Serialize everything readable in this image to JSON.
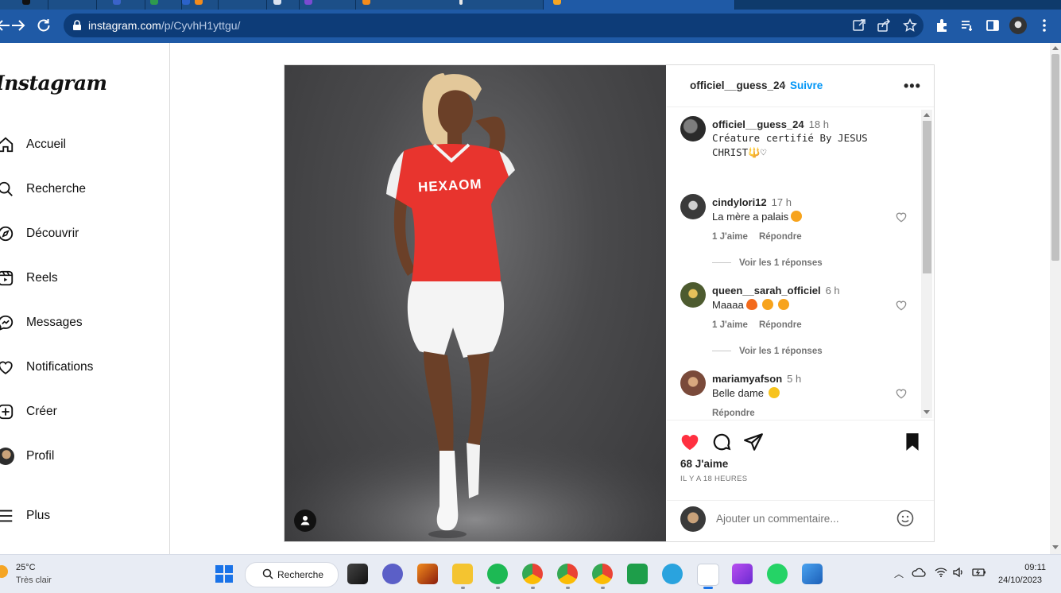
{
  "browser": {
    "url_host": "instagram.com",
    "url_path": "/p/CyvhH1yttgu/"
  },
  "sidebar": {
    "logo": "Instagram",
    "items": [
      {
        "label": "Accueil",
        "icon": "home-icon"
      },
      {
        "label": "Recherche",
        "icon": "search-icon"
      },
      {
        "label": "Découvrir",
        "icon": "compass-icon"
      },
      {
        "label": "Reels",
        "icon": "reels-icon"
      },
      {
        "label": "Messages",
        "icon": "messenger-icon"
      },
      {
        "label": "Notifications",
        "icon": "heart-icon"
      },
      {
        "label": "Créer",
        "icon": "plus-square-icon"
      },
      {
        "label": "Profil",
        "icon": "avatar"
      },
      {
        "label": "Plus",
        "icon": "menu-icon"
      }
    ]
  },
  "post": {
    "author": "officiel__guess_24",
    "separator": "•",
    "follow_label": "Suivre",
    "more_label": "•••",
    "caption": {
      "user": "officiel__guess_24",
      "time": "18 h",
      "text": "Créature certifié By JESUS CHRIST🔱♡"
    },
    "comments": [
      {
        "user": "cindylori12",
        "time": "17 h",
        "text": "La mère a palais",
        "emojis": [
          "heart-eyes"
        ],
        "likes_label": "1 J'aime",
        "reply_label": "Répondre",
        "view_replies": "Voir les 1 réponses"
      },
      {
        "user": "queen__sarah_officiel",
        "time": "6 h",
        "text": "Maaaa",
        "emojis": [
          "fire",
          "heart-eyes",
          "heart-eyes"
        ],
        "likes_label": "1 J'aime",
        "reply_label": "Répondre",
        "view_replies": "Voir les 1 réponses"
      },
      {
        "user": "mariamyafson",
        "time": "5 h",
        "text": "Belle dame",
        "emojis": [
          "smile"
        ],
        "reply_label": "Répondre"
      }
    ],
    "likes": "68 J'aime",
    "posted_ago": "IL Y A 18 HEURES",
    "liked": true,
    "saved": true,
    "comment_placeholder": "Ajouter un commentaire..."
  },
  "taskbar": {
    "temperature": "25°C",
    "condition": "Très clair",
    "search_label": "Recherche",
    "time": "09:11",
    "date": "24/10/2023"
  },
  "colors": {
    "chrome_blue": "#1f5aa6",
    "instagram_link": "#0095f6",
    "like_red": "#ff3040",
    "jersey_red": "#e8342e"
  }
}
